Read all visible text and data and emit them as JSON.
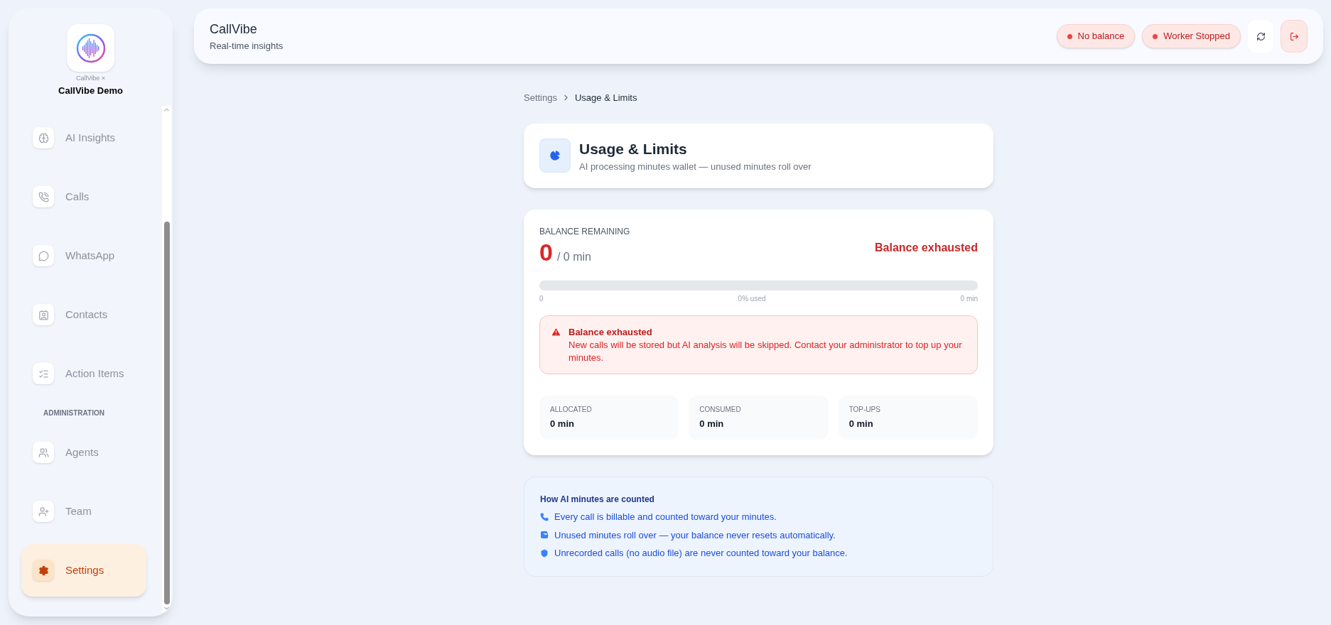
{
  "brand": {
    "caption": "CallVibe ×",
    "name": "CallVibe Demo"
  },
  "sidebar": {
    "items": [
      {
        "kind": "nav",
        "label": "AI Insights",
        "selected": false
      },
      {
        "kind": "nav",
        "label": "Calls",
        "selected": false
      },
      {
        "kind": "nav",
        "label": "WhatsApp",
        "selected": false
      },
      {
        "kind": "nav",
        "label": "Contacts",
        "selected": false
      },
      {
        "kind": "nav",
        "label": "Action Items",
        "selected": false
      },
      {
        "kind": "section",
        "label": "ADMINISTRATION"
      },
      {
        "kind": "nav",
        "label": "Agents",
        "selected": false
      },
      {
        "kind": "nav",
        "label": "Team",
        "selected": false
      },
      {
        "kind": "nav",
        "label": "Settings",
        "selected": true
      }
    ]
  },
  "header": {
    "title": "CallVibe",
    "subtitle": "Real-time insights",
    "badges": [
      "No balance",
      "Worker Stopped"
    ]
  },
  "breadcrumb": [
    "Settings",
    "Usage & Limits"
  ],
  "page": {
    "title": "Usage & Limits",
    "subtitle": "AI processing minutes wallet — unused minutes roll over"
  },
  "balance": {
    "label": "BALANCE REMAINING",
    "value": "0",
    "total": "/ 0 min",
    "status": "Balance exhausted",
    "level": 0,
    "scale_start": "0",
    "scale_mid": "0% used",
    "scale_end": "0 min",
    "alert": {
      "title": "Balance exhausted",
      "text": "New calls will be stored but AI analysis will be skipped. Contact your administrator to top up your minutes."
    },
    "stats": [
      {
        "label": "ALLOCATED",
        "value": "0 min"
      },
      {
        "label": "CONSUMED",
        "value": "0 min"
      },
      {
        "label": "TOP-UPS",
        "value": "0 min"
      }
    ]
  },
  "info": {
    "title": "How AI minutes are counted",
    "items": [
      {
        "text": "Every call is billable and counted toward your minutes."
      },
      {
        "text": "Unused minutes roll over — your balance never resets automatically."
      },
      {
        "text": "Unrecorded calls (no audio file) are never counted toward your balance."
      }
    ]
  }
}
